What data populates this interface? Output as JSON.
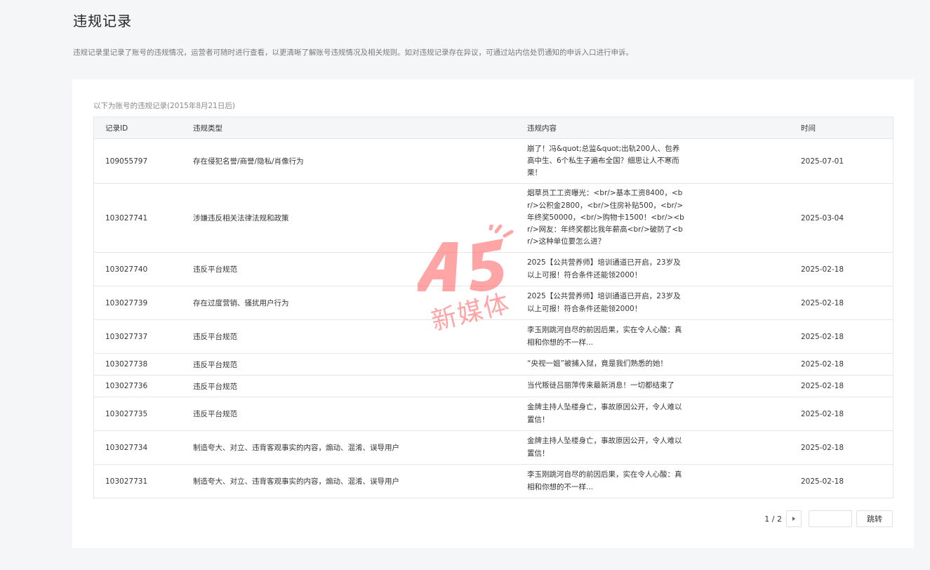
{
  "header": {
    "title": "违规记录",
    "description": "违规记录里记录了账号的违规情况，运营者可随时进行查看，以更清晰了解账号违规情况及相关规则。如对违规记录存在异议，可通过站内信处罚通知的申诉入口进行申诉。"
  },
  "table": {
    "caption": "以下为账号的违规记录(2015年8月21日后)",
    "headers": [
      "记录ID",
      "违规类型",
      "违规内容",
      "时间"
    ],
    "rows": [
      {
        "id": "109055797",
        "type": "存在侵犯名誉/商誉/隐私/肖像行为",
        "content": "崩了！冯&quot;总监&quot;出轨200人、包养高中生、6个私生子遍布全国？细思让人不寒而栗！",
        "time": "2025-07-01"
      },
      {
        "id": "103027741",
        "type": "涉嫌违反相关法律法规和政策",
        "content": "烟草员工工资曝光：<br/>基本工资8400，<br/>公积金2800，<br/>住房补贴500，<br/>年终奖50000，<br/>购物卡1500！<br/><br/>网友：年终奖都比我年薪高<br/>破防了<br/>这种单位要怎么进？",
        "time": "2025-03-04"
      },
      {
        "id": "103027740",
        "type": "违反平台规范",
        "content": "2025【公共营养师】培训通道已开启，23岁及以上可报！符合条件还能领2000！",
        "time": "2025-02-18"
      },
      {
        "id": "103027739",
        "type": "存在过度营销、骚扰用户行为",
        "content": "2025【公共营养师】培训通道已开启，23岁及以上可报！符合条件还能领2000！",
        "time": "2025-02-18"
      },
      {
        "id": "103027737",
        "type": "违反平台规范",
        "content": "李玉刚跳河自尽的前因后果，实在令人心酸：真相和你想的不一样...",
        "time": "2025-02-18"
      },
      {
        "id": "103027738",
        "type": "违反平台规范",
        "content": "“央视一姐”被捕入狱，竟是我们熟悉的她！",
        "time": "2025-02-18"
      },
      {
        "id": "103027736",
        "type": "违反平台规范",
        "content": "当代叛徒吕丽萍传来最新消息！一切都结束了",
        "time": "2025-02-18"
      },
      {
        "id": "103027735",
        "type": "违反平台规范",
        "content": "金牌主持人坠楼身亡，事故原因公开，令人难以置信！",
        "time": "2025-02-18"
      },
      {
        "id": "103027734",
        "type": "制造夸大、对立、违背客观事实的内容，煽动、混淆、误导用户",
        "content": "金牌主持人坠楼身亡，事故原因公开，令人难以置信！",
        "time": "2025-02-18"
      },
      {
        "id": "103027731",
        "type": "制造夸大、对立、违背客观事实的内容，煽动、混淆、误导用户",
        "content": "李玉刚跳河自尽的前因后果，实在令人心酸：真相和你想的不一样...",
        "time": "2025-02-18"
      }
    ]
  },
  "pager": {
    "page_text": "1 / 2",
    "next_icon": "caret-right-icon",
    "input_value": "",
    "jump_label": "跳转"
  },
  "watermark": {
    "logo": "A5",
    "text": "新媒体",
    "color": "#ff5c5c"
  },
  "colors": {
    "background": "#f5f6f7",
    "card": "#ffffff",
    "table_header": "#f5f6f8",
    "border": "#e4e6eb"
  }
}
